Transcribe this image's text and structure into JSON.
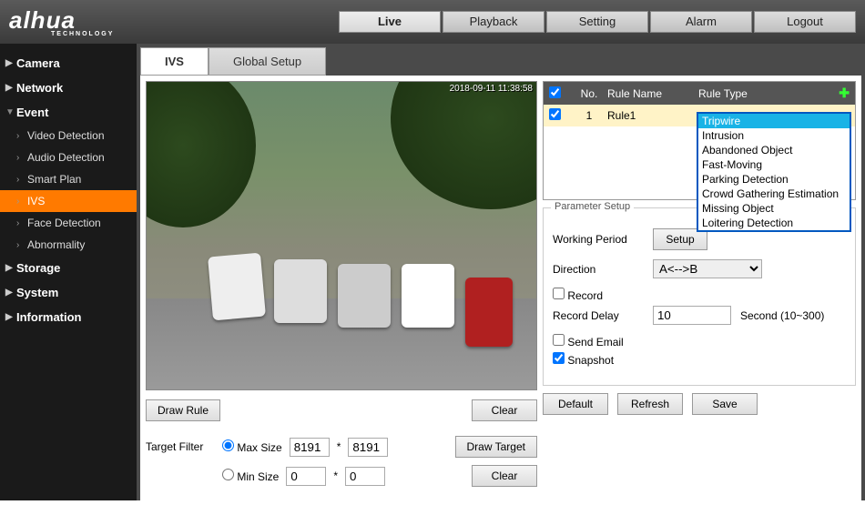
{
  "brand": {
    "name": "alhua",
    "sub": "TECHNOLOGY"
  },
  "nav": {
    "live": "Live",
    "playback": "Playback",
    "setting": "Setting",
    "alarm": "Alarm",
    "logout": "Logout"
  },
  "sidebar": {
    "camera": "Camera",
    "network": "Network",
    "event": "Event",
    "video_detection": "Video Detection",
    "audio_detection": "Audio Detection",
    "smart_plan": "Smart Plan",
    "ivs": "IVS",
    "face_detection": "Face Detection",
    "abnormality": "Abnormality",
    "storage": "Storage",
    "system": "System",
    "information": "Information"
  },
  "subtabs": {
    "ivs": "IVS",
    "global": "Global Setup"
  },
  "preview": {
    "timestamp": "2018-09-11  11:38:58"
  },
  "buttons": {
    "draw_rule": "Draw Rule",
    "clear": "Clear",
    "draw_target": "Draw Target",
    "setup": "Setup",
    "default": "Default",
    "refresh": "Refresh",
    "save": "Save"
  },
  "filter": {
    "label": "Target Filter",
    "max": "Max Size",
    "min": "Min Size",
    "max_w": "8191",
    "max_h": "8191",
    "min_w": "0",
    "min_h": "0",
    "sep": "*"
  },
  "rules": {
    "head": {
      "no": "No.",
      "name": "Rule Name",
      "type": "Rule Type"
    },
    "row1": {
      "no": "1",
      "name": "Rule1"
    },
    "types": {
      "tripwire": "Tripwire",
      "intrusion": "Intrusion",
      "abandoned": "Abandoned Object",
      "fast": "Fast-Moving",
      "parking": "Parking Detection",
      "crowd": "Crowd Gathering Estimation",
      "missing": "Missing Object",
      "loitering": "Loitering Detection"
    }
  },
  "param": {
    "legend": "Parameter Setup",
    "working_period": "Working Period",
    "direction": "Direction",
    "direction_val": "A<-->B",
    "record": "Record",
    "record_delay": "Record Delay",
    "record_delay_val": "10",
    "record_delay_hint": "Second (10~300)",
    "send_email": "Send Email",
    "snapshot": "Snapshot"
  }
}
